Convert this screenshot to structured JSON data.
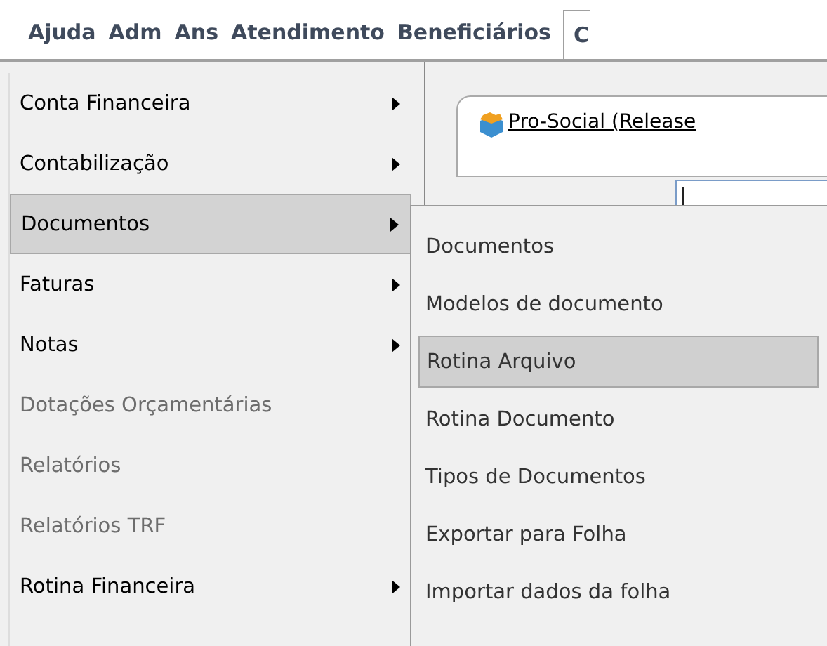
{
  "menu_bar": [
    {
      "label": "Ajuda",
      "selected": false
    },
    {
      "label": "Adm",
      "selected": false
    },
    {
      "label": "Ans",
      "selected": false
    },
    {
      "label": "Atendimento",
      "selected": false
    },
    {
      "label": "Beneficiários",
      "selected": false
    },
    {
      "label": "C",
      "selected": true
    }
  ],
  "window": {
    "link": "Pro-Social (Release"
  },
  "menu": [
    {
      "label": "Conta Financeira",
      "has_submenu": true,
      "disabled": false,
      "selected": false
    },
    {
      "label": "Contabilização",
      "has_submenu": true,
      "disabled": false,
      "selected": false
    },
    {
      "label": "Documentos",
      "has_submenu": true,
      "disabled": false,
      "selected": true
    },
    {
      "label": "Faturas",
      "has_submenu": true,
      "disabled": false,
      "selected": false
    },
    {
      "label": "Notas",
      "has_submenu": true,
      "disabled": false,
      "selected": false
    },
    {
      "label": "Dotações Orçamentárias",
      "has_submenu": false,
      "disabled": true,
      "selected": false
    },
    {
      "label": "Relatórios",
      "has_submenu": false,
      "disabled": true,
      "selected": false
    },
    {
      "label": "Relatórios TRF",
      "has_submenu": false,
      "disabled": true,
      "selected": false
    },
    {
      "label": "Rotina Financeira",
      "has_submenu": true,
      "disabled": false,
      "selected": false
    }
  ],
  "submenu": [
    {
      "label": "Documentos",
      "selected": false
    },
    {
      "label": "Modelos de documento",
      "selected": false
    },
    {
      "label": "Rotina Arquivo",
      "selected": true
    },
    {
      "label": "Rotina Documento",
      "selected": false
    },
    {
      "label": "Tipos de Documentos",
      "selected": false
    },
    {
      "label": "Exportar para Folha",
      "selected": false
    },
    {
      "label": "Importar dados da folha",
      "selected": false
    }
  ]
}
